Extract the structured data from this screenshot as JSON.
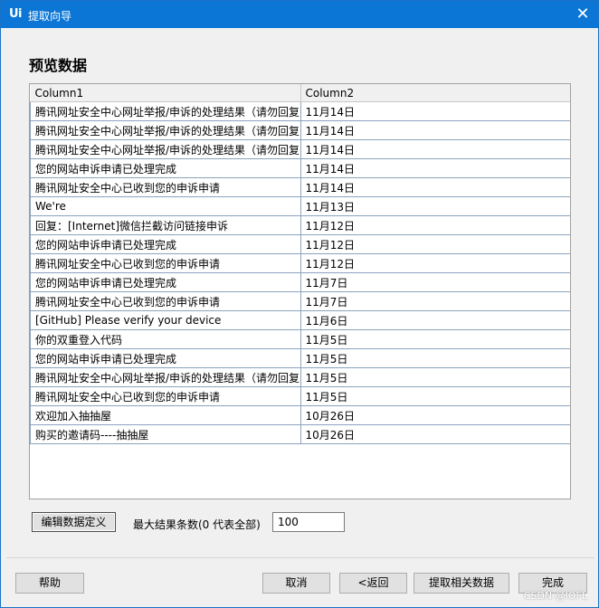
{
  "window": {
    "title": "提取向导",
    "app_icon": "Ui",
    "close_icon": "close-icon"
  },
  "heading": "预览数据",
  "table": {
    "columns": [
      "Column1",
      "Column2"
    ],
    "rows": [
      [
        "腾讯网址安全中心网址举报/申诉的处理结果（请勿回复",
        "11月14日"
      ],
      [
        "腾讯网址安全中心网址举报/申诉的处理结果（请勿回复",
        "11月14日"
      ],
      [
        "腾讯网址安全中心网址举报/申诉的处理结果（请勿回复",
        "11月14日"
      ],
      [
        "您的网站申诉申请已处理完成",
        "11月14日"
      ],
      [
        "腾讯网址安全中心已收到您的申诉申请",
        "11月14日"
      ],
      [
        "We're",
        "11月13日"
      ],
      [
        "回复：[Internet]微信拦截访问链接申诉",
        "11月12日"
      ],
      [
        "您的网站申诉申请已处理完成",
        "11月12日"
      ],
      [
        "腾讯网址安全中心已收到您的申诉申请",
        "11月12日"
      ],
      [
        "您的网站申诉申请已处理完成",
        "11月7日"
      ],
      [
        "腾讯网址安全中心已收到您的申诉申请",
        "11月7日"
      ],
      [
        "[GitHub] Please verify your device",
        "11月6日"
      ],
      [
        "你的双重登入代码",
        "11月5日"
      ],
      [
        "您的网站申诉申请已处理完成",
        "11月5日"
      ],
      [
        "腾讯网址安全中心网址举报/申诉的处理结果（请勿回复",
        "11月5日"
      ],
      [
        "腾讯网址安全中心已收到您的申诉申请",
        "11月5日"
      ],
      [
        "欢迎加入抽抽屋",
        "10月26日"
      ],
      [
        "购买的邀请码----抽抽屋",
        "10月26日"
      ]
    ]
  },
  "controls": {
    "edit_label": "编辑数据定义",
    "limit_label": "最大结果条数(0 代表全部)",
    "limit_value": "100"
  },
  "footer": {
    "help": "帮助",
    "cancel": "取消",
    "back": "<返回",
    "extract_related": "提取相关数据",
    "finish": "完成"
  },
  "watermark": "CSDN @IOFL"
}
